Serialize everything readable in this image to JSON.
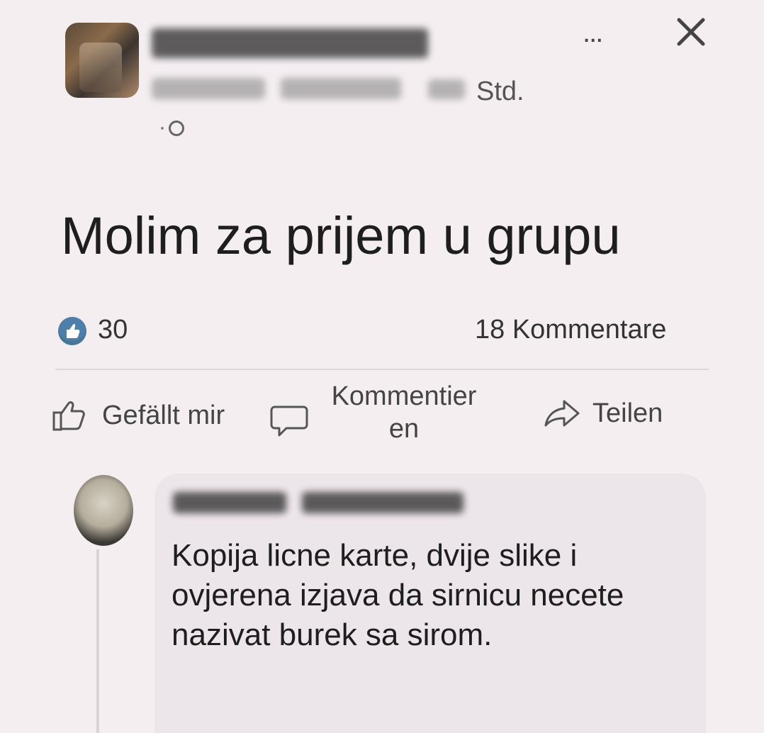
{
  "post": {
    "time": "Std.",
    "dot": "·",
    "text": "Molim za prijem u grupu",
    "reactions_count": "30",
    "comments_count": "18 Kommentare"
  },
  "header": {
    "more_label": "...",
    "close_label": "×"
  },
  "actions": {
    "like_label": "Gefällt mir",
    "comment_label_line1": "Kommentier",
    "comment_label_line2": "en",
    "share_label": "Teilen"
  },
  "comment": {
    "text": "Kopija licne karte, dvije slike i ovjerena izjava da sirnicu necete nazivat burek sa sirom."
  },
  "colors": {
    "background": "#f4eef1",
    "like_badge": "#4f7fa8",
    "bubble": "#ece5e9"
  },
  "icons": [
    "thumbs-up-icon",
    "comment-icon",
    "share-icon",
    "globe-icon",
    "close-icon",
    "more-icon"
  ]
}
